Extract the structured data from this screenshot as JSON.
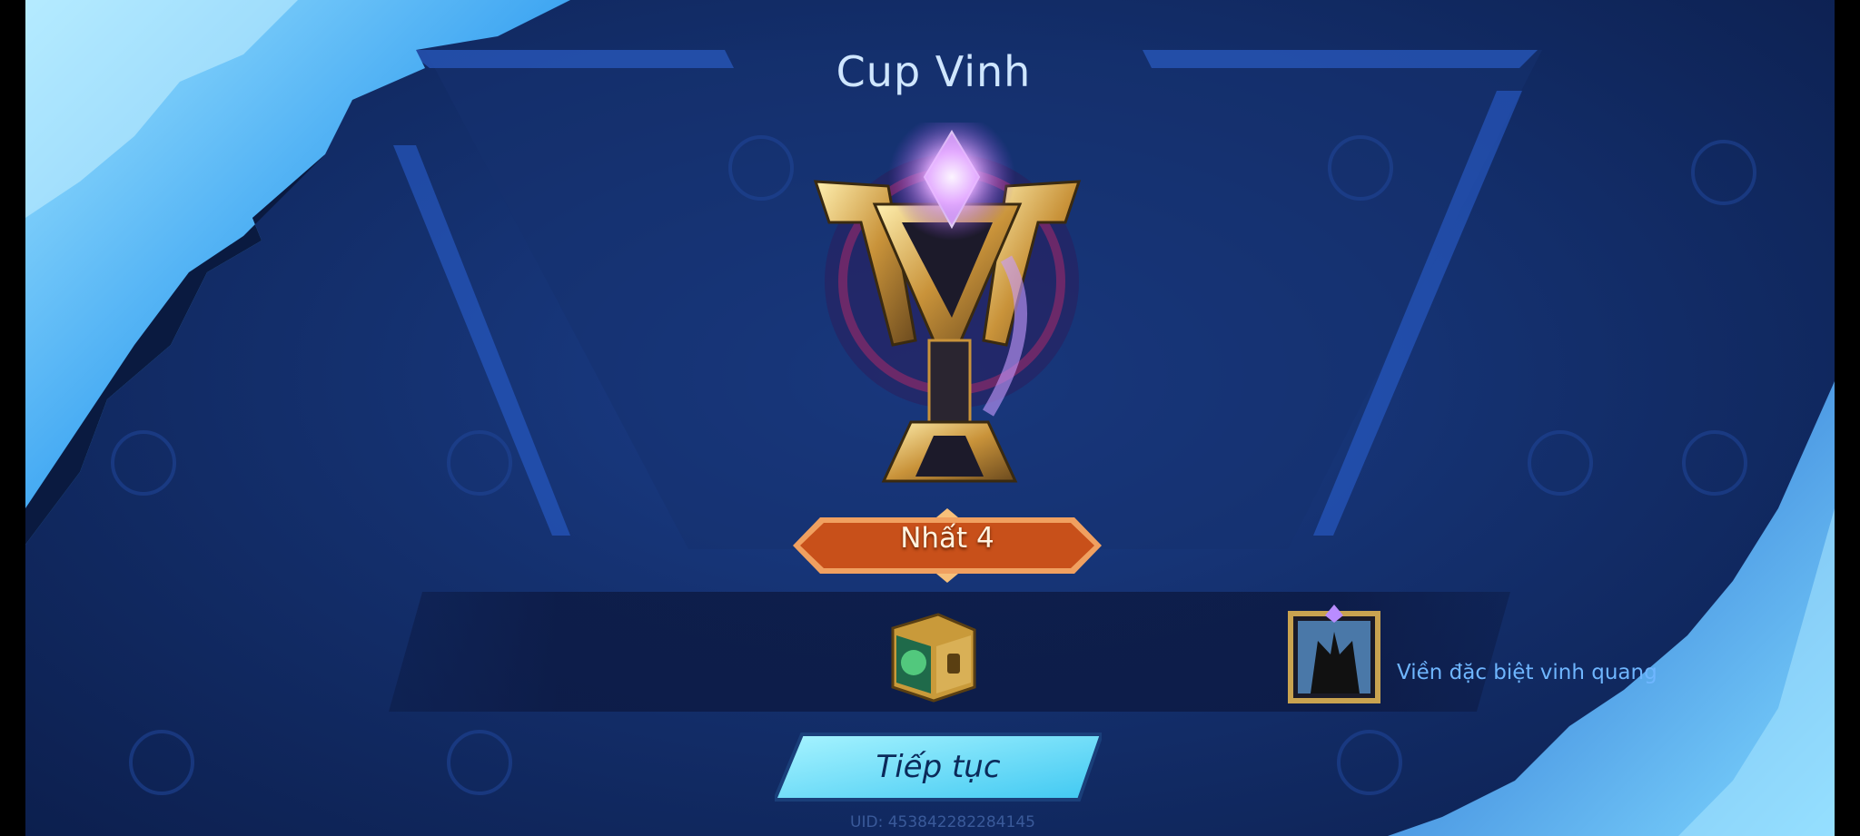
{
  "screen": {
    "title": "Cup Vinh",
    "rank_label": "Nhất 4",
    "rewards": {
      "chest_icon": "treasure-chest-icon",
      "frame_icon": "avatar-frame-icon",
      "frame_label": "Viền đặc biệt vinh quang"
    },
    "continue_label": "Tiếp tục",
    "uid": "UID: 453842282284145"
  },
  "colors": {
    "title": "#cfe6ff",
    "banner": "#c8501a",
    "button": "#6fe6ff",
    "label_blue": "#6fb6ff"
  }
}
